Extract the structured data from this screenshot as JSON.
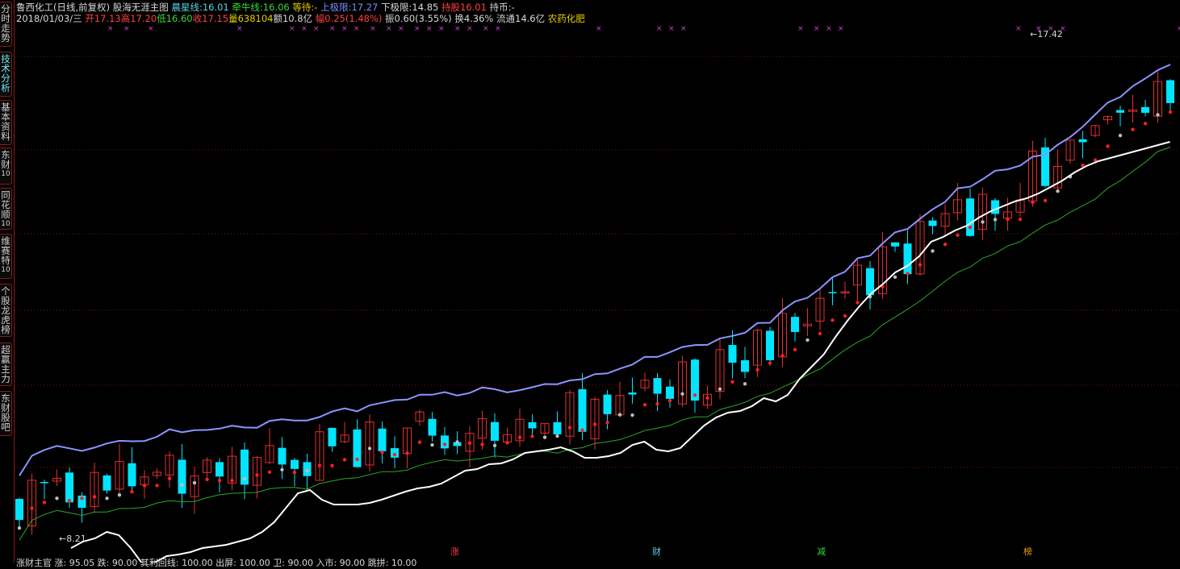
{
  "sidebar": {
    "tabs": [
      {
        "label": "分时走势",
        "num": ""
      },
      {
        "label": "技术分析",
        "num": ""
      },
      {
        "label": "基本资料",
        "num": ""
      },
      {
        "label": "东财",
        "num": "10"
      },
      {
        "label": "同花顺",
        "num": "10"
      },
      {
        "label": "维赛特",
        "num": "10"
      },
      {
        "label": "个股龙虎榜",
        "num": ""
      },
      {
        "label": "超赢主力",
        "num": ""
      },
      {
        "label": "东财股吧",
        "num": ""
      }
    ]
  },
  "header": {
    "stock": "鲁西化工(日线,前复权)",
    "indicator": "股海无涯主图",
    "chenxing_label": "晨星线:",
    "chenxing_value": "16.01",
    "qianniu_label": "牵牛线:",
    "qianniu_value": "16.06",
    "dengdai_label": "等待:",
    "dengdai_value": "-",
    "upper_label": "上极限:",
    "upper_value": "17.27",
    "lower_label": "下极限:",
    "lower_value": "14.85",
    "hold_label": "持股",
    "hold_value": "16.01",
    "cash_label": "持币:",
    "cash_value": "-"
  },
  "quote": {
    "date": "2018/01/03/三",
    "open_label": "开",
    "open": "17.13",
    "high_label": "高",
    "high": "17.20",
    "low_label": "低",
    "low": "16.60",
    "close_label": "收",
    "close": "17.15",
    "vol_label": "量",
    "vol": "638104",
    "amount_label": "额",
    "amount": "10.8亿",
    "chg_label": "幅",
    "chg": "0.25(1.48%)",
    "amp_label": "振",
    "amp": "0.60(3.55%)",
    "turn_label": "换",
    "turn": "4.36%",
    "float_label": "流通",
    "float": "14.6亿",
    "sector": "农药化肥"
  },
  "annotations": {
    "high": "17.42",
    "low": "8.21"
  },
  "footer": {
    "text": "涨财主官 涨: 95.05  跌: 90.00  其利回线: 100.00  出屏: 100.00  卫: 90.00  入市: 90.00  跳拼: 10.00",
    "markers": [
      "涨",
      "财",
      "减",
      "榜"
    ]
  },
  "colors": {
    "up": "#e03030",
    "down": "#00e5ff",
    "upper_band": "#8c94ff",
    "ma": "#2aa82a",
    "momentum": "#ffffff",
    "marker_red": "#ff1f1f",
    "marker_grey": "#bdbdbd",
    "magenta": "#d040d0"
  }
}
